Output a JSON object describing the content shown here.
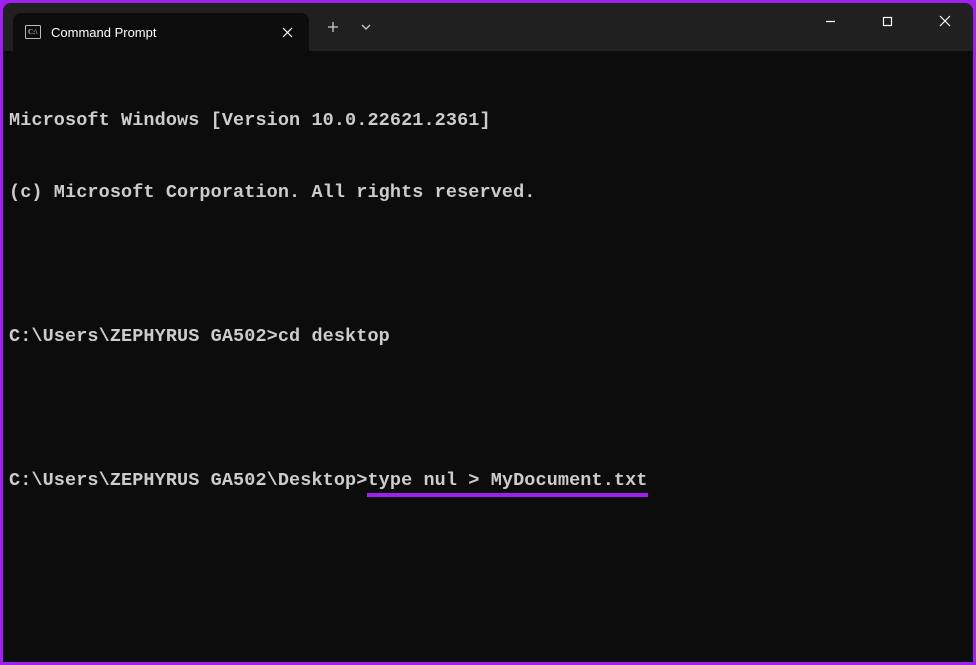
{
  "accent_color": "#a020f0",
  "tab": {
    "title": "Command Prompt",
    "icon_name": "cmd-icon"
  },
  "terminal": {
    "version_line": "Microsoft Windows [Version 10.0.22621.2361]",
    "copyright_line": "(c) Microsoft Corporation. All rights reserved.",
    "entries": [
      {
        "prompt": "C:\\Users\\ZEPHYRUS GA502>",
        "command": "cd desktop"
      }
    ],
    "current": {
      "prompt": "C:\\Users\\ZEPHYRUS GA502\\Desktop>",
      "command": "type nul > MyDocument.txt"
    }
  }
}
